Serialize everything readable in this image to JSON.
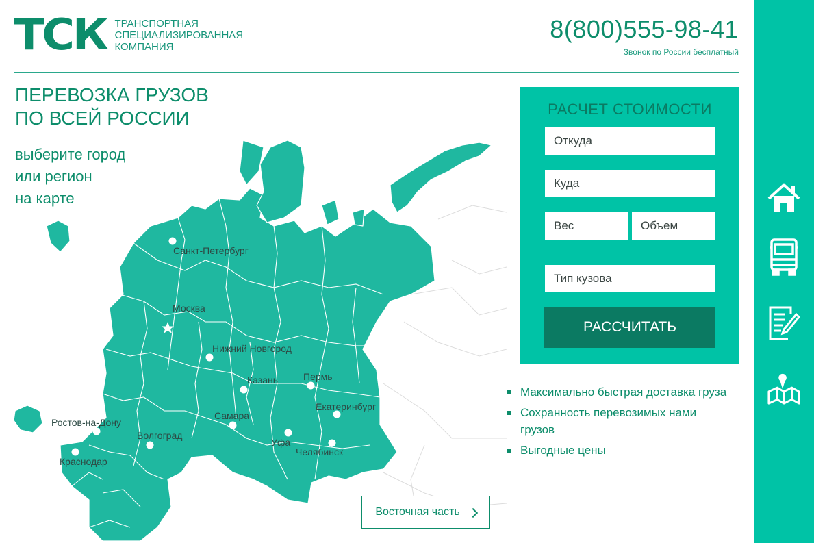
{
  "header": {
    "logo_mark": "ТСК",
    "logo_lines": [
      "ТРАНСПОРТНАЯ",
      "СПЕЦИАЛИЗИРОВАННАЯ",
      "КОМПАНИЯ"
    ],
    "phone": "8(800)555-98-41",
    "phone_note": "Звонок по России бесплатный"
  },
  "hero": {
    "title_lines": [
      "ПЕРЕВОЗКА ГРУЗОВ",
      "ПО ВСЕЙ РОССИИ"
    ],
    "subtitle_lines": [
      "выберите город",
      "или регион",
      "на карте"
    ]
  },
  "map": {
    "cities": [
      {
        "name": "Санкт-Петербург",
        "marker": "dot"
      },
      {
        "name": "Москва",
        "marker": "star"
      },
      {
        "name": "Нижний Новгород",
        "marker": "dot"
      },
      {
        "name": "Казань",
        "marker": "dot"
      },
      {
        "name": "Пермь",
        "marker": "dot"
      },
      {
        "name": "Екатеринбург",
        "marker": "dot"
      },
      {
        "name": "Самара",
        "marker": "dot"
      },
      {
        "name": "Уфа",
        "marker": "dot"
      },
      {
        "name": "Челябинск",
        "marker": "dot"
      },
      {
        "name": "Ростов-на-Дону",
        "marker": "dot"
      },
      {
        "name": "Волгоград",
        "marker": "dot"
      },
      {
        "name": "Краснодар",
        "marker": "dot"
      }
    ],
    "east_button": "Восточная часть"
  },
  "calculator": {
    "title": "РАСЧЕТ СТОИМОСТИ",
    "from_placeholder": "Откуда",
    "to_placeholder": "Куда",
    "weight_placeholder": "Вес",
    "volume_placeholder": "Объем",
    "body_placeholder": "Тип кузова",
    "submit_label": "РАССЧИТАТЬ"
  },
  "features": [
    "Максимально быстрая доставка груза",
    "Сохранность перевозимых нами грузов",
    "Выгодные цены"
  ],
  "sidebar": {
    "icons": [
      "home-icon",
      "truck-icon",
      "document-icon",
      "map-pin-icon"
    ]
  },
  "colors": {
    "brand_dark": "#0b7a62",
    "brand": "#0d8d6b",
    "accent": "#00c3a6",
    "map_fill": "#1fb8a0"
  }
}
